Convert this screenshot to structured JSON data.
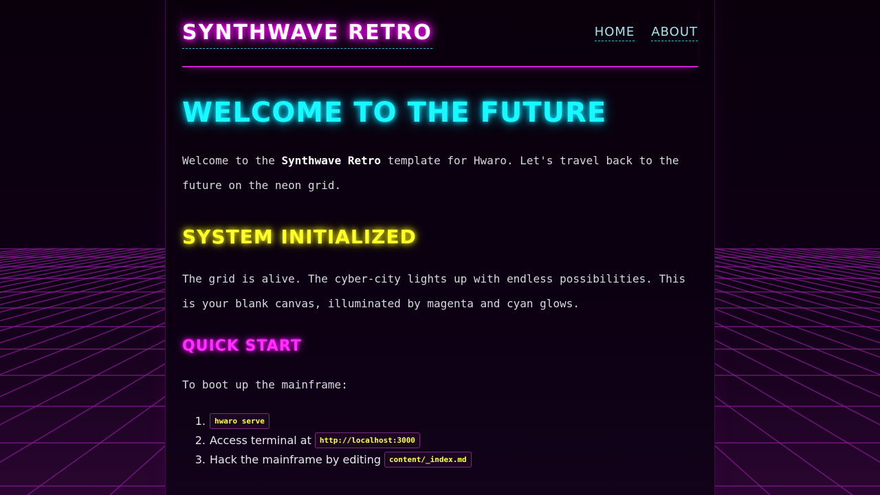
{
  "header": {
    "site_title": "SYNTHWAVE RETRO",
    "nav": [
      {
        "label": "HOME"
      },
      {
        "label": "ABOUT"
      }
    ]
  },
  "main": {
    "heading": "WELCOME TO THE FUTURE",
    "intro": {
      "before": "Welcome to the ",
      "bold": "Synthwave Retro",
      "after": " template for Hwaro. Let's travel back to the future on the neon grid."
    },
    "section_heading": "SYSTEM INITIALIZED",
    "section_text": "The grid is alive. The cyber-city lights up with endless possibilities. This is your blank canvas, illuminated by magenta and cyan glows.",
    "quick_start_heading": "QUICK START",
    "quick_start_text": "To boot up the mainframe:",
    "steps": [
      {
        "num": "1.",
        "text": "",
        "code": "hwaro serve"
      },
      {
        "num": "2.",
        "text": "Access terminal at",
        "code": "http://localhost:3000"
      },
      {
        "num": "3.",
        "text": "Hack the mainframe by editing",
        "code": "content/_index.md"
      }
    ]
  },
  "colors": {
    "magenta": "#ff00ff",
    "cyan": "#19f7ff",
    "yellow": "#ffff2a",
    "background": "#0a000c"
  }
}
